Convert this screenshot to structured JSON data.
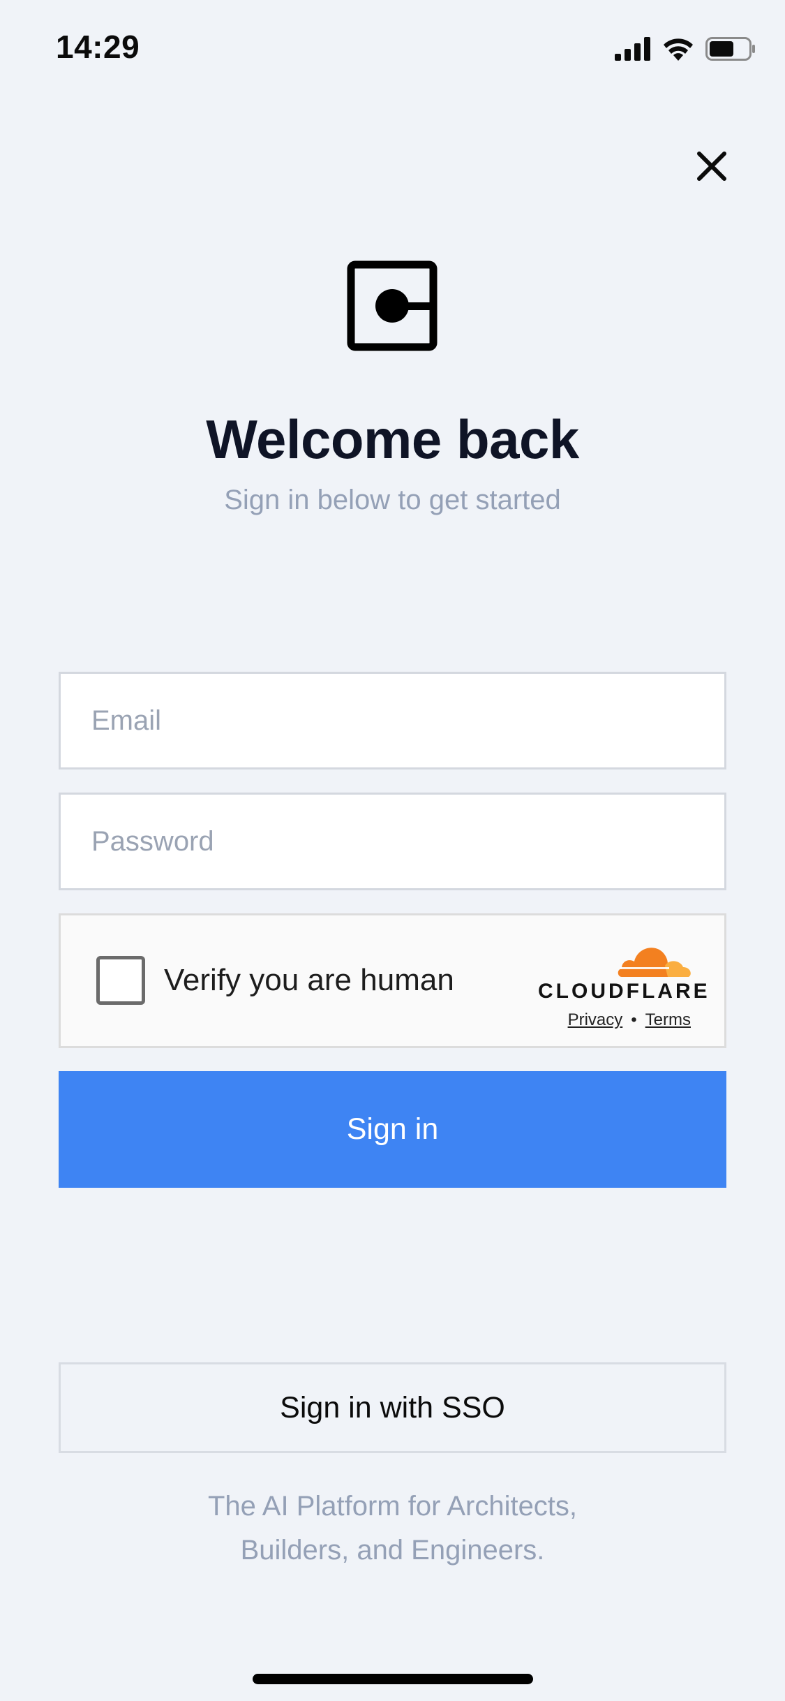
{
  "status_bar": {
    "time": "14:29",
    "icons": [
      "cellular-signal-icon",
      "wifi-icon",
      "battery-icon"
    ]
  },
  "close": {
    "icon": "close-icon"
  },
  "logo": {
    "icon": "app-logo-icon"
  },
  "header": {
    "title": "Welcome back",
    "subtitle": "Sign in below to get started"
  },
  "form": {
    "email": {
      "placeholder": "Email",
      "value": ""
    },
    "password": {
      "placeholder": "Password",
      "value": ""
    },
    "turnstile": {
      "label": "Verify you are human",
      "brand": "CLOUDFLARE",
      "privacy_link": "Privacy",
      "separator": "•",
      "terms_link": "Terms",
      "brand_colors": [
        "#f38020",
        "#faae40"
      ]
    },
    "signin_label": "Sign in"
  },
  "sso": {
    "label": "Sign in with SSO"
  },
  "footer": {
    "tagline_line1": "The AI Platform for Architects,",
    "tagline_line2": "Builders, and Engineers."
  },
  "colors": {
    "background": "#f0f3f8",
    "primary": "#3e84f3",
    "muted_text": "#94a0b6",
    "title_text": "#0f1426"
  }
}
